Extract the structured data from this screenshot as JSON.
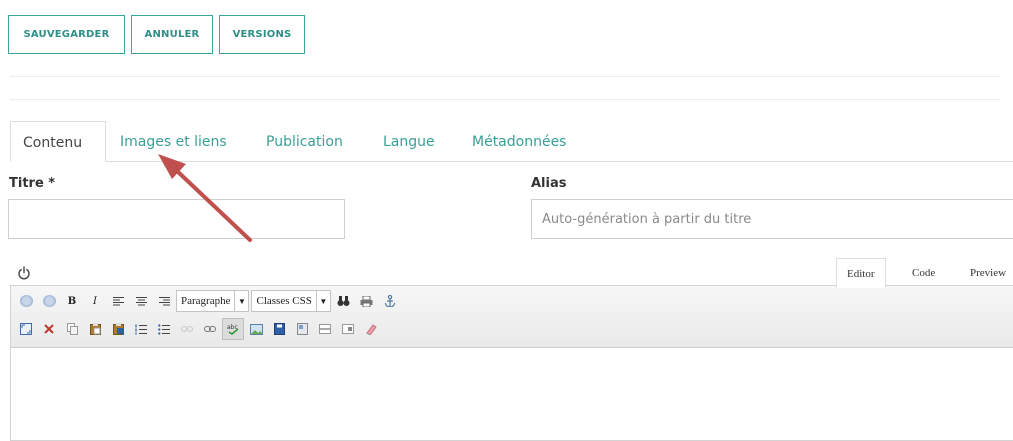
{
  "toolbar": {
    "save_label": "SAUVEGARDER",
    "cancel_label": "ANNULER",
    "versions_label": "VERSIONS",
    "accent": "#3aa59b"
  },
  "tabs": [
    {
      "label": "Contenu",
      "active": true
    },
    {
      "label": "Images et liens",
      "active": false
    },
    {
      "label": "Publication",
      "active": false
    },
    {
      "label": "Langue",
      "active": false
    },
    {
      "label": "Métadonnées",
      "active": false
    }
  ],
  "form": {
    "title_label": "Titre *",
    "title_value": "",
    "alias_label": "Alias",
    "alias_placeholder": "Auto-génération à partir du titre"
  },
  "editor": {
    "view_tabs": [
      "Editor",
      "Code",
      "Preview"
    ],
    "active_view": "Editor",
    "format_select": "Paragraphe",
    "class_select": "Classes CSS",
    "row1_icons": [
      "undo-icon",
      "redo-icon",
      "bold-icon",
      "italic-icon",
      "align-left-icon",
      "align-center-icon",
      "align-right-icon",
      "format-select",
      "class-select",
      "find-icon",
      "print-icon",
      "anchor-icon"
    ],
    "row2_icons": [
      "fullscreen-icon",
      "cut-icon",
      "copy-icon",
      "paste-icon",
      "paste-word-icon",
      "ordered-list-icon",
      "unordered-list-icon",
      "unlink-icon",
      "link-icon",
      "spellcheck-icon",
      "image-icon",
      "media-icon",
      "template-icon",
      "horizontal-rule-icon",
      "article-icon",
      "eraser-icon"
    ],
    "bold_glyph": "B",
    "italic_glyph": "I",
    "content": ""
  },
  "annotation": {
    "color": "#c0504d"
  }
}
